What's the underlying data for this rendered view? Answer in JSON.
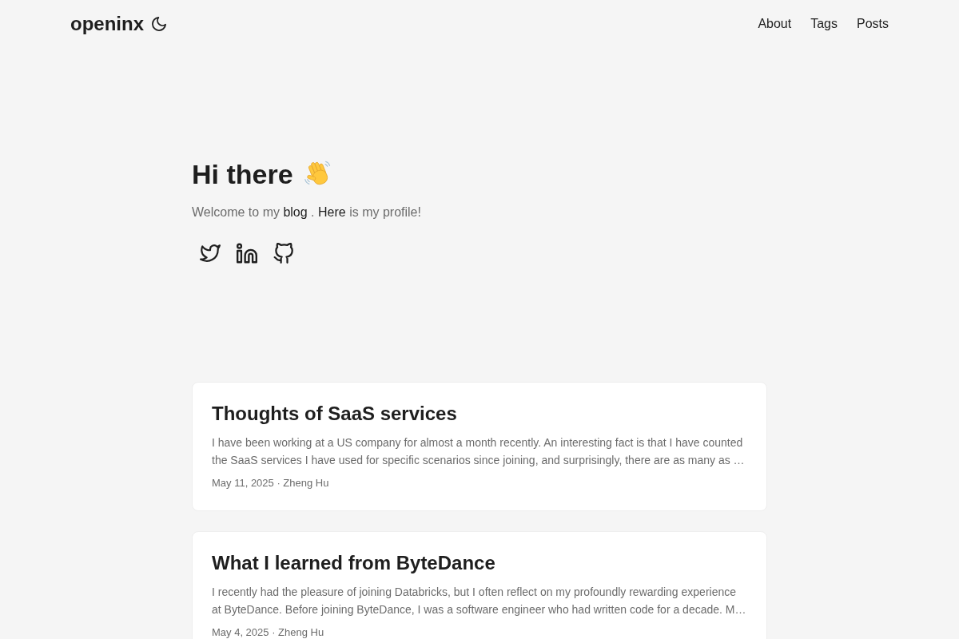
{
  "header": {
    "logo": "openinx",
    "nav": [
      {
        "label": "About"
      },
      {
        "label": "Tags"
      },
      {
        "label": "Posts"
      }
    ]
  },
  "profile": {
    "title": "Hi there",
    "intro": {
      "text_1": "Welcome to my",
      "link_1": "blog",
      "text_2": ".",
      "link_2": "Here",
      "text_3": "is my profile!"
    },
    "social_links": [
      {
        "kind": "twitter"
      },
      {
        "kind": "linkedin"
      },
      {
        "kind": "github"
      }
    ]
  },
  "posts": [
    {
      "title": "Thoughts of SaaS services",
      "summary": "I have been working at a US company for almost a month recently. An interesting fact is that I have counted the SaaS services I have used for specific scenarios since joining, and surprisingly, there are as many as …",
      "meta": "May 11, 2025 · Zheng Hu"
    },
    {
      "title": "What I learned from ByteDance",
      "summary": "I recently had the pleasure of joining Databricks, but I often reflect on my profoundly rewarding experience at ByteDance. Before joining ByteDance, I was a software engineer who had written code for a decade. M…",
      "meta": "May 4, 2025 · Zheng Hu"
    }
  ]
}
